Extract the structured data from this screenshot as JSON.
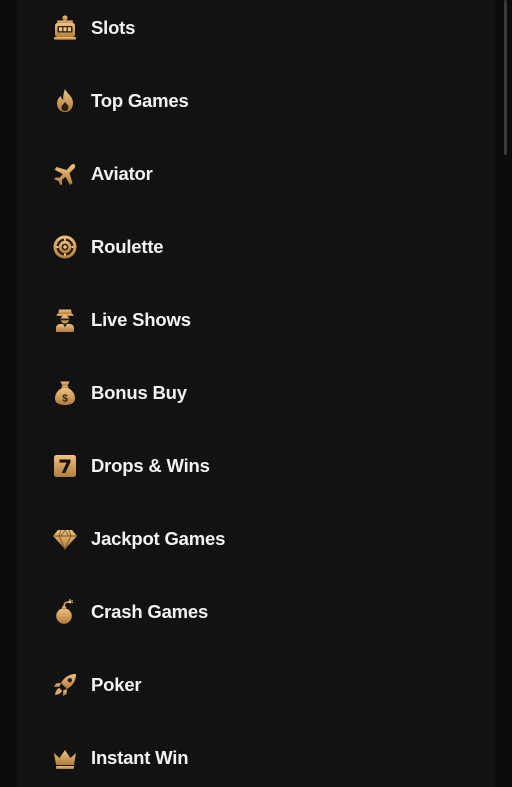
{
  "theme": {
    "icon_gold": "#d9a865",
    "icon_gold_dark": "#b07d3e",
    "text": "#f2f2f2",
    "panel_bg": "#121212"
  },
  "menu": {
    "items": [
      {
        "label": "Slots",
        "icon": "slot-machine-icon"
      },
      {
        "label": "Top Games",
        "icon": "flame-icon"
      },
      {
        "label": "Aviator",
        "icon": "airplane-icon"
      },
      {
        "label": "Roulette",
        "icon": "roulette-wheel-icon"
      },
      {
        "label": "Live Shows",
        "icon": "live-host-icon"
      },
      {
        "label": "Bonus Buy",
        "icon": "money-bag-icon"
      },
      {
        "label": "Drops & Wins",
        "icon": "lucky-seven-icon"
      },
      {
        "label": "Jackpot Games",
        "icon": "diamond-icon"
      },
      {
        "label": "Crash Games",
        "icon": "bomb-icon"
      },
      {
        "label": "Poker",
        "icon": "rocket-icon"
      },
      {
        "label": "Instant Win",
        "icon": "crown-icon"
      }
    ]
  }
}
